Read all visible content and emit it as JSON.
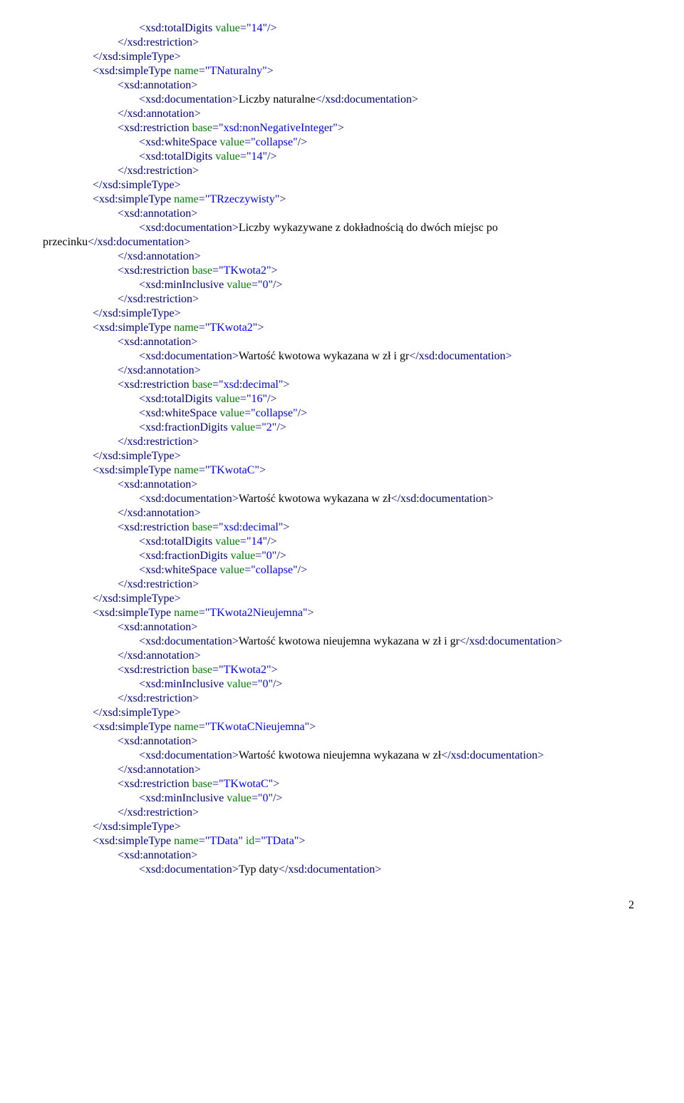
{
  "lines": [
    {
      "cls": "i4",
      "parts": [
        {
          "c": "tag",
          "t": "<xsd:totalDigits"
        },
        {
          "c": "attr",
          "t": " value"
        },
        {
          "c": "tag",
          "t": "="
        },
        {
          "c": "val",
          "t": "\"14\""
        },
        {
          "c": "tag",
          "t": "/>"
        }
      ]
    },
    {
      "cls": "i3",
      "parts": [
        {
          "c": "tag",
          "t": "</xsd:restriction>"
        }
      ]
    },
    {
      "cls": "i2",
      "parts": [
        {
          "c": "tag",
          "t": "</xsd:simpleType>"
        }
      ]
    },
    {
      "cls": "i2",
      "parts": [
        {
          "c": "tag",
          "t": "<xsd:simpleType"
        },
        {
          "c": "attr",
          "t": " name"
        },
        {
          "c": "tag",
          "t": "="
        },
        {
          "c": "val",
          "t": "\"TNaturalny\""
        },
        {
          "c": "tag",
          "t": ">"
        }
      ]
    },
    {
      "cls": "i3",
      "parts": [
        {
          "c": "tag",
          "t": "<xsd:annotation>"
        }
      ]
    },
    {
      "cls": "i4",
      "parts": [
        {
          "c": "tag",
          "t": "<xsd:documentation>"
        },
        {
          "c": "text",
          "t": "Liczby naturalne"
        },
        {
          "c": "tag",
          "t": "</xsd:documentation>"
        }
      ]
    },
    {
      "cls": "i3",
      "parts": [
        {
          "c": "tag",
          "t": "</xsd:annotation>"
        }
      ]
    },
    {
      "cls": "i3",
      "parts": [
        {
          "c": "tag",
          "t": "<xsd:restriction"
        },
        {
          "c": "attr",
          "t": " base"
        },
        {
          "c": "tag",
          "t": "="
        },
        {
          "c": "val",
          "t": "\"xsd:nonNegativeInteger\""
        },
        {
          "c": "tag",
          "t": ">"
        }
      ]
    },
    {
      "cls": "i4",
      "parts": [
        {
          "c": "tag",
          "t": "<xsd:whiteSpace"
        },
        {
          "c": "attr",
          "t": " value"
        },
        {
          "c": "tag",
          "t": "="
        },
        {
          "c": "val",
          "t": "\"collapse\""
        },
        {
          "c": "tag",
          "t": "/>"
        }
      ]
    },
    {
      "cls": "i4",
      "parts": [
        {
          "c": "tag",
          "t": "<xsd:totalDigits"
        },
        {
          "c": "attr",
          "t": " value"
        },
        {
          "c": "tag",
          "t": "="
        },
        {
          "c": "val",
          "t": "\"14\""
        },
        {
          "c": "tag",
          "t": "/>"
        }
      ]
    },
    {
      "cls": "i3",
      "parts": [
        {
          "c": "tag",
          "t": "</xsd:restriction>"
        }
      ]
    },
    {
      "cls": "i2",
      "parts": [
        {
          "c": "tag",
          "t": "</xsd:simpleType>"
        }
      ]
    },
    {
      "cls": "i2",
      "parts": [
        {
          "c": "tag",
          "t": "<xsd:simpleType"
        },
        {
          "c": "attr",
          "t": " name"
        },
        {
          "c": "tag",
          "t": "="
        },
        {
          "c": "val",
          "t": "\"TRzeczywisty\""
        },
        {
          "c": "tag",
          "t": ">"
        }
      ]
    },
    {
      "cls": "i3",
      "parts": [
        {
          "c": "tag",
          "t": "<xsd:annotation>"
        }
      ]
    },
    {
      "cls": "i4",
      "parts": [
        {
          "c": "tag",
          "t": "<xsd:documentation>"
        },
        {
          "c": "text",
          "t": "Liczby wykazywane z dokładnością do dwóch miejsc po"
        }
      ]
    },
    {
      "cls": "noindent",
      "parts": [
        {
          "c": "text",
          "t": "przecinku"
        },
        {
          "c": "tag",
          "t": "</xsd:documentation>"
        }
      ]
    },
    {
      "cls": "i3",
      "parts": [
        {
          "c": "tag",
          "t": "</xsd:annotation>"
        }
      ]
    },
    {
      "cls": "i3",
      "parts": [
        {
          "c": "tag",
          "t": "<xsd:restriction"
        },
        {
          "c": "attr",
          "t": " base"
        },
        {
          "c": "tag",
          "t": "="
        },
        {
          "c": "val",
          "t": "\"TKwota2\""
        },
        {
          "c": "tag",
          "t": ">"
        }
      ]
    },
    {
      "cls": "i4",
      "parts": [
        {
          "c": "tag",
          "t": "<xsd:minInclusive"
        },
        {
          "c": "attr",
          "t": " value"
        },
        {
          "c": "tag",
          "t": "="
        },
        {
          "c": "val",
          "t": "\"0\""
        },
        {
          "c": "tag",
          "t": "/>"
        }
      ]
    },
    {
      "cls": "i3",
      "parts": [
        {
          "c": "tag",
          "t": "</xsd:restriction>"
        }
      ]
    },
    {
      "cls": "i2",
      "parts": [
        {
          "c": "tag",
          "t": "</xsd:simpleType>"
        }
      ]
    },
    {
      "cls": "i2",
      "parts": [
        {
          "c": "tag",
          "t": "<xsd:simpleType"
        },
        {
          "c": "attr",
          "t": " name"
        },
        {
          "c": "tag",
          "t": "="
        },
        {
          "c": "val",
          "t": "\"TKwota2\""
        },
        {
          "c": "tag",
          "t": ">"
        }
      ]
    },
    {
      "cls": "i3",
      "parts": [
        {
          "c": "tag",
          "t": "<xsd:annotation>"
        }
      ]
    },
    {
      "cls": "i4",
      "parts": [
        {
          "c": "tag",
          "t": "<xsd:documentation>"
        },
        {
          "c": "text",
          "t": "Wartość kwotowa wykazana w zł i gr"
        },
        {
          "c": "tag",
          "t": "</xsd:documentation>"
        }
      ]
    },
    {
      "cls": "i3",
      "parts": [
        {
          "c": "tag",
          "t": "</xsd:annotation>"
        }
      ]
    },
    {
      "cls": "i3",
      "parts": [
        {
          "c": "tag",
          "t": "<xsd:restriction"
        },
        {
          "c": "attr",
          "t": " base"
        },
        {
          "c": "tag",
          "t": "="
        },
        {
          "c": "val",
          "t": "\"xsd:decimal\""
        },
        {
          "c": "tag",
          "t": ">"
        }
      ]
    },
    {
      "cls": "i4",
      "parts": [
        {
          "c": "tag",
          "t": "<xsd:totalDigits"
        },
        {
          "c": "attr",
          "t": " value"
        },
        {
          "c": "tag",
          "t": "="
        },
        {
          "c": "val",
          "t": "\"16\""
        },
        {
          "c": "tag",
          "t": "/>"
        }
      ]
    },
    {
      "cls": "i4",
      "parts": [
        {
          "c": "tag",
          "t": "<xsd:whiteSpace"
        },
        {
          "c": "attr",
          "t": " value"
        },
        {
          "c": "tag",
          "t": "="
        },
        {
          "c": "val",
          "t": "\"collapse\""
        },
        {
          "c": "tag",
          "t": "/>"
        }
      ]
    },
    {
      "cls": "i4",
      "parts": [
        {
          "c": "tag",
          "t": "<xsd:fractionDigits"
        },
        {
          "c": "attr",
          "t": " value"
        },
        {
          "c": "tag",
          "t": "="
        },
        {
          "c": "val",
          "t": "\"2\""
        },
        {
          "c": "tag",
          "t": "/>"
        }
      ]
    },
    {
      "cls": "i3",
      "parts": [
        {
          "c": "tag",
          "t": "</xsd:restriction>"
        }
      ]
    },
    {
      "cls": "i2",
      "parts": [
        {
          "c": "tag",
          "t": "</xsd:simpleType>"
        }
      ]
    },
    {
      "cls": "i2",
      "parts": [
        {
          "c": "tag",
          "t": "<xsd:simpleType"
        },
        {
          "c": "attr",
          "t": " name"
        },
        {
          "c": "tag",
          "t": "="
        },
        {
          "c": "val",
          "t": "\"TKwotaC\""
        },
        {
          "c": "tag",
          "t": ">"
        }
      ]
    },
    {
      "cls": "i3",
      "parts": [
        {
          "c": "tag",
          "t": "<xsd:annotation>"
        }
      ]
    },
    {
      "cls": "i4",
      "parts": [
        {
          "c": "tag",
          "t": "<xsd:documentation>"
        },
        {
          "c": "text",
          "t": "Wartość kwotowa wykazana w zł"
        },
        {
          "c": "tag",
          "t": "</xsd:documentation>"
        }
      ]
    },
    {
      "cls": "i3",
      "parts": [
        {
          "c": "tag",
          "t": "</xsd:annotation>"
        }
      ]
    },
    {
      "cls": "i3",
      "parts": [
        {
          "c": "tag",
          "t": "<xsd:restriction"
        },
        {
          "c": "attr",
          "t": " base"
        },
        {
          "c": "tag",
          "t": "="
        },
        {
          "c": "val",
          "t": "\"xsd:decimal\""
        },
        {
          "c": "tag",
          "t": ">"
        }
      ]
    },
    {
      "cls": "i4",
      "parts": [
        {
          "c": "tag",
          "t": "<xsd:totalDigits"
        },
        {
          "c": "attr",
          "t": " value"
        },
        {
          "c": "tag",
          "t": "="
        },
        {
          "c": "val",
          "t": "\"14\""
        },
        {
          "c": "tag",
          "t": "/>"
        }
      ]
    },
    {
      "cls": "i4",
      "parts": [
        {
          "c": "tag",
          "t": "<xsd:fractionDigits"
        },
        {
          "c": "attr",
          "t": " value"
        },
        {
          "c": "tag",
          "t": "="
        },
        {
          "c": "val",
          "t": "\"0\""
        },
        {
          "c": "tag",
          "t": "/>"
        }
      ]
    },
    {
      "cls": "i4",
      "parts": [
        {
          "c": "tag",
          "t": "<xsd:whiteSpace"
        },
        {
          "c": "attr",
          "t": " value"
        },
        {
          "c": "tag",
          "t": "="
        },
        {
          "c": "val",
          "t": "\"collapse\""
        },
        {
          "c": "tag",
          "t": "/>"
        }
      ]
    },
    {
      "cls": "i3",
      "parts": [
        {
          "c": "tag",
          "t": "</xsd:restriction>"
        }
      ]
    },
    {
      "cls": "i2",
      "parts": [
        {
          "c": "tag",
          "t": "</xsd:simpleType>"
        }
      ]
    },
    {
      "cls": "i2",
      "parts": [
        {
          "c": "tag",
          "t": "<xsd:simpleType"
        },
        {
          "c": "attr",
          "t": " name"
        },
        {
          "c": "tag",
          "t": "="
        },
        {
          "c": "val",
          "t": "\"TKwota2Nieujemna\""
        },
        {
          "c": "tag",
          "t": ">"
        }
      ]
    },
    {
      "cls": "i3",
      "parts": [
        {
          "c": "tag",
          "t": "<xsd:annotation>"
        }
      ]
    },
    {
      "cls": "i4",
      "parts": [
        {
          "c": "tag",
          "t": "<xsd:documentation>"
        },
        {
          "c": "text",
          "t": "Wartość kwotowa nieujemna wykazana w zł i gr"
        },
        {
          "c": "tag",
          "t": "</xsd:documentation>"
        }
      ]
    },
    {
      "cls": "i3",
      "parts": [
        {
          "c": "tag",
          "t": "</xsd:annotation>"
        }
      ]
    },
    {
      "cls": "i3",
      "parts": [
        {
          "c": "tag",
          "t": "<xsd:restriction"
        },
        {
          "c": "attr",
          "t": " base"
        },
        {
          "c": "tag",
          "t": "="
        },
        {
          "c": "val",
          "t": "\"TKwota2\""
        },
        {
          "c": "tag",
          "t": ">"
        }
      ]
    },
    {
      "cls": "i4",
      "parts": [
        {
          "c": "tag",
          "t": "<xsd:minInclusive"
        },
        {
          "c": "attr",
          "t": " value"
        },
        {
          "c": "tag",
          "t": "="
        },
        {
          "c": "val",
          "t": "\"0\""
        },
        {
          "c": "tag",
          "t": "/>"
        }
      ]
    },
    {
      "cls": "i3",
      "parts": [
        {
          "c": "tag",
          "t": "</xsd:restriction>"
        }
      ]
    },
    {
      "cls": "i2",
      "parts": [
        {
          "c": "tag",
          "t": "</xsd:simpleType>"
        }
      ]
    },
    {
      "cls": "i2",
      "parts": [
        {
          "c": "tag",
          "t": "<xsd:simpleType"
        },
        {
          "c": "attr",
          "t": " name"
        },
        {
          "c": "tag",
          "t": "="
        },
        {
          "c": "val",
          "t": "\"TKwotaCNieujemna\""
        },
        {
          "c": "tag",
          "t": ">"
        }
      ]
    },
    {
      "cls": "i3",
      "parts": [
        {
          "c": "tag",
          "t": "<xsd:annotation>"
        }
      ]
    },
    {
      "cls": "i4",
      "parts": [
        {
          "c": "tag",
          "t": "<xsd:documentation>"
        },
        {
          "c": "text",
          "t": "Wartość kwotowa nieujemna wykazana w zł"
        },
        {
          "c": "tag",
          "t": "</xsd:documentation>"
        }
      ]
    },
    {
      "cls": "i3",
      "parts": [
        {
          "c": "tag",
          "t": "</xsd:annotation>"
        }
      ]
    },
    {
      "cls": "i3",
      "parts": [
        {
          "c": "tag",
          "t": "<xsd:restriction"
        },
        {
          "c": "attr",
          "t": " base"
        },
        {
          "c": "tag",
          "t": "="
        },
        {
          "c": "val",
          "t": "\"TKwotaC\""
        },
        {
          "c": "tag",
          "t": ">"
        }
      ]
    },
    {
      "cls": "i4",
      "parts": [
        {
          "c": "tag",
          "t": "<xsd:minInclusive"
        },
        {
          "c": "attr",
          "t": " value"
        },
        {
          "c": "tag",
          "t": "="
        },
        {
          "c": "val",
          "t": "\"0\""
        },
        {
          "c": "tag",
          "t": "/>"
        }
      ]
    },
    {
      "cls": "i3",
      "parts": [
        {
          "c": "tag",
          "t": "</xsd:restriction>"
        }
      ]
    },
    {
      "cls": "i2",
      "parts": [
        {
          "c": "tag",
          "t": "</xsd:simpleType>"
        }
      ]
    },
    {
      "cls": "i2",
      "parts": [
        {
          "c": "tag",
          "t": "<xsd:simpleType"
        },
        {
          "c": "attr",
          "t": " name"
        },
        {
          "c": "tag",
          "t": "="
        },
        {
          "c": "val",
          "t": "\"TData\""
        },
        {
          "c": "attr",
          "t": " id"
        },
        {
          "c": "tag",
          "t": "="
        },
        {
          "c": "val",
          "t": "\"TData\""
        },
        {
          "c": "tag",
          "t": ">"
        }
      ]
    },
    {
      "cls": "i3",
      "parts": [
        {
          "c": "tag",
          "t": "<xsd:annotation>"
        }
      ]
    },
    {
      "cls": "i4",
      "parts": [
        {
          "c": "tag",
          "t": "<xsd:documentation>"
        },
        {
          "c": "text",
          "t": "Typ daty"
        },
        {
          "c": "tag",
          "t": "</xsd:documentation>"
        }
      ]
    }
  ],
  "pagenum": "2"
}
